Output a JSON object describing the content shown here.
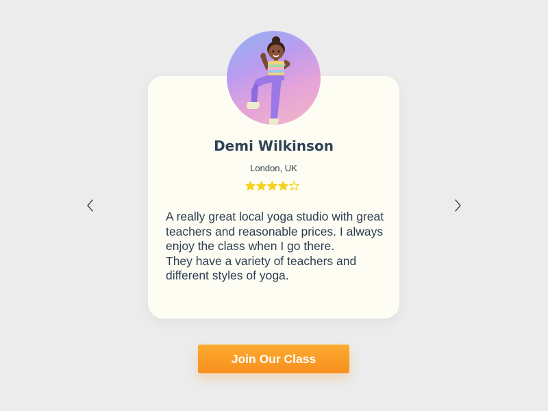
{
  "testimonial": {
    "name": "Demi Wilkinson",
    "location": "London, UK",
    "rating": 4,
    "rating_max": 5,
    "review_lines": [
      "A really great local yoga studio with great teachers and reasonable prices. I always enjoy the class when I go there.",
      "They have a variety of teachers and different styles of yoga."
    ],
    "avatar_icon": "person-avatar-icon"
  },
  "navigation": {
    "prev_icon": "chevron-left-icon",
    "next_icon": "chevron-right-icon"
  },
  "cta": {
    "label": "Join Our Class"
  },
  "colors": {
    "background": "#ececed",
    "card": "#fdfdf3",
    "name_text": "#2f4356",
    "body_text": "#2e3d52",
    "star": "#f7d21b",
    "button": "#f99a25"
  }
}
